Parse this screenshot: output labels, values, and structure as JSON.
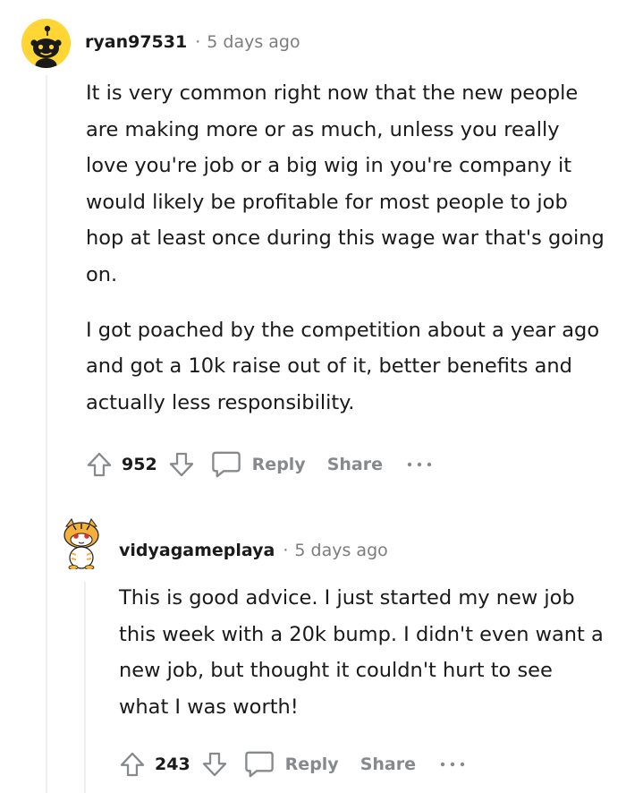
{
  "comments": [
    {
      "username": "ryan97531",
      "separator": "·",
      "time": "5 days ago",
      "paragraphs": [
        "It is very common right now that the new people are making more or as much, unless you really love you're job or a big wig in you're company it would likely be profitable for most people to job hop at least once during this wage war that's going on.",
        "I got poached by the competition about a year ago and got a 10k raise out of it, better benefits and actually less responsibility."
      ],
      "score": "952",
      "reply_label": "Reply",
      "share_label": "Share",
      "avatar_icon": "snoo-avatar-yellow"
    },
    {
      "username": "vidyagameplaya",
      "separator": "·",
      "time": "5 days ago",
      "paragraphs": [
        "This is good advice. I just started my new job this week with a 20k bump. I didn't even want a new job, but thought it couldn't hurt to see what I was worth!"
      ],
      "score": "243",
      "reply_label": "Reply",
      "share_label": "Share",
      "avatar_icon": "snoo-avatar-tiger"
    }
  ],
  "icons": {
    "upvote": "upvote-arrow-icon",
    "downvote": "downvote-arrow-icon",
    "reply": "speech-bubble-icon",
    "more": "more-options-dots-icon"
  },
  "colors": {
    "text": "#1a1a1b",
    "muted": "#7c7c7c",
    "action": "#878a8c",
    "thread_line": "#edeff1",
    "avatar_yellow": "#ffd635"
  }
}
